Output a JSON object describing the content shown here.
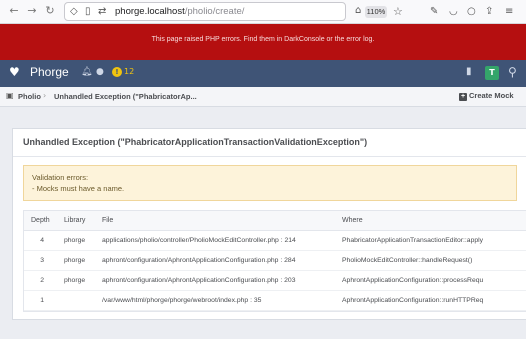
{
  "browser": {
    "url_host": "phorge.localhost",
    "url_path": "/pholio/create/",
    "zoom": "110%"
  },
  "error_banner": {
    "text": "This page raised PHP errors. Find them in DarkConsole or the error log."
  },
  "header": {
    "brand": "Phorge",
    "setup_count": "12",
    "avatar_letter": "T"
  },
  "crumbs": {
    "app": "Pholio",
    "current": "Unhandled Exception (\"PhabricatorAp...",
    "create_label": "Create Mock"
  },
  "panel": {
    "title": "Unhandled Exception (\"PhabricatorApplicationTransactionValidationException\")",
    "warning_title": "Validation errors:",
    "warning_item": "- Mocks must have a name."
  },
  "trace": {
    "headers": {
      "depth": "Depth",
      "library": "Library",
      "file": "File",
      "where": "Where"
    },
    "rows": [
      {
        "depth": "4",
        "library": "phorge",
        "file": "applications/pholio/controller/PholioMockEditController.php : 214",
        "where": "PhabricatorApplicationTransactionEditor::apply"
      },
      {
        "depth": "3",
        "library": "phorge",
        "file": "aphront/configuration/AphrontApplicationConfiguration.php : 284",
        "where": "PholioMockEditController::handleRequest()"
      },
      {
        "depth": "2",
        "library": "phorge",
        "file": "aphront/configuration/AphrontApplicationConfiguration.php : 203",
        "where": "AphrontApplicationConfiguration::processRequ"
      },
      {
        "depth": "1",
        "library": "",
        "file": "/var/www/html/phorge/phorge/webroot/index.php : 35",
        "where": "AphrontApplicationConfiguration::runHTTPReq"
      }
    ]
  },
  "colors": {
    "error_banner": "#b50f10",
    "header": "#3f5476",
    "warning_bg": "#fdf3da"
  }
}
